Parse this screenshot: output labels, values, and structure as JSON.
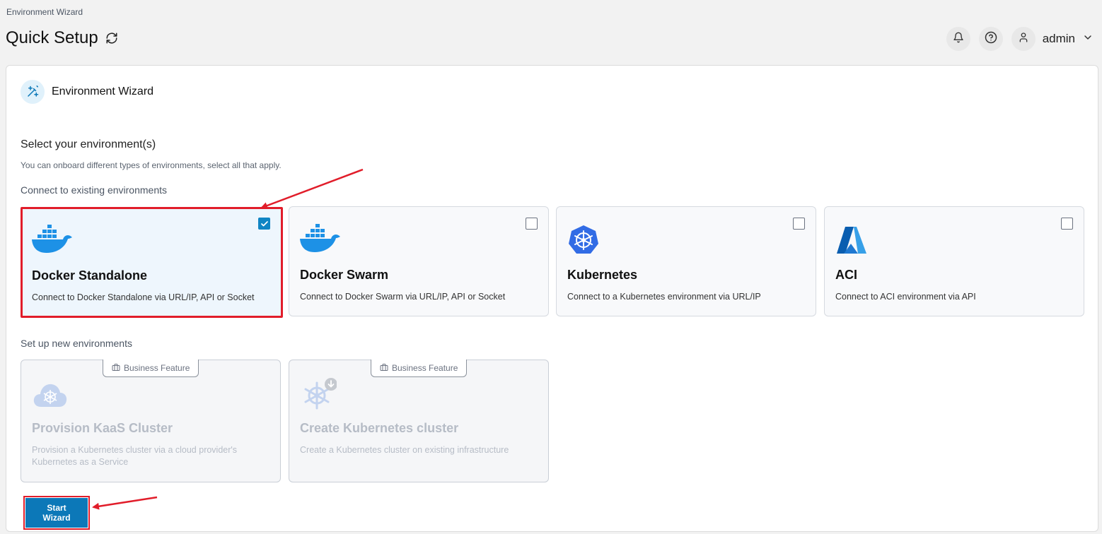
{
  "breadcrumb": "Environment Wizard",
  "page_title": "Quick Setup",
  "header": {
    "notifications_icon": "bell-icon",
    "help_icon": "help-circle-icon",
    "user_icon": "user-icon",
    "username": "admin"
  },
  "widget": {
    "icon": "magic-wand-icon",
    "title": "Environment Wizard"
  },
  "section": {
    "title": "Select your environment(s)",
    "description": "You can onboard different types of environments, select all that apply."
  },
  "existing": {
    "label": "Connect to existing environments",
    "cards": [
      {
        "title": "Docker Standalone",
        "description": "Connect to Docker Standalone via URL/IP, API or Socket",
        "checked": true,
        "icon": "docker-icon"
      },
      {
        "title": "Docker Swarm",
        "description": "Connect to Docker Swarm via URL/IP, API or Socket",
        "checked": false,
        "icon": "docker-icon"
      },
      {
        "title": "Kubernetes",
        "description": "Connect to a Kubernetes environment via URL/IP",
        "checked": false,
        "icon": "kubernetes-icon"
      },
      {
        "title": "ACI",
        "description": "Connect to ACI environment via API",
        "checked": false,
        "icon": "azure-icon"
      }
    ]
  },
  "new_envs": {
    "label": "Set up new environments",
    "cards": [
      {
        "badge": "Business Feature",
        "title": "Provision KaaS Cluster",
        "description": "Provision a Kubernetes cluster via a cloud provider's Kubernetes as a Service",
        "icon": "cloud-kubernetes-icon"
      },
      {
        "badge": "Business Feature",
        "title": "Create Kubernetes cluster",
        "description": "Create a Kubernetes cluster on existing infrastructure",
        "icon": "kubernetes-install-icon"
      }
    ]
  },
  "start_button": "Start Wizard",
  "colors": {
    "accent": "#0c78b8",
    "highlight": "#e11d2a",
    "docker_blue": "#1d91e6",
    "kubernetes_blue": "#326ce5"
  }
}
